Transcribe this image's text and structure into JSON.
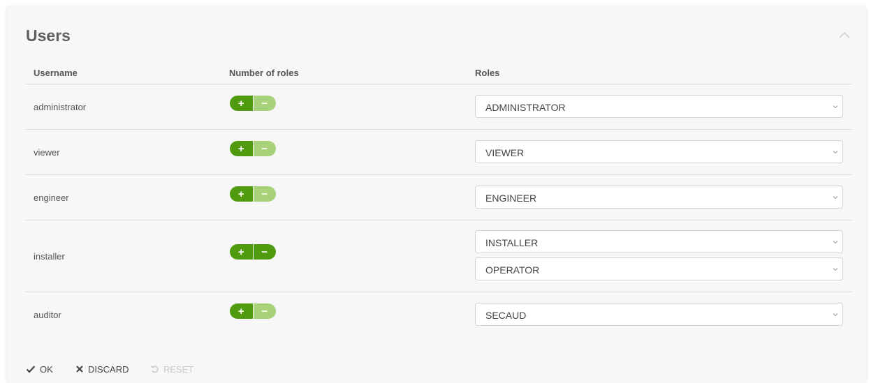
{
  "panel": {
    "title": "Users"
  },
  "table": {
    "headers": {
      "username": "Username",
      "num_roles": "Number of roles",
      "roles": "Roles"
    },
    "rows": [
      {
        "username": "administrator",
        "roles": [
          "ADMINISTRATOR"
        ],
        "minus_enabled": false
      },
      {
        "username": "viewer",
        "roles": [
          "VIEWER"
        ],
        "minus_enabled": false
      },
      {
        "username": "engineer",
        "roles": [
          "ENGINEER"
        ],
        "minus_enabled": false
      },
      {
        "username": "installer",
        "roles": [
          "INSTALLER",
          "OPERATOR"
        ],
        "minus_enabled": true
      },
      {
        "username": "auditor",
        "roles": [
          "SECAUD"
        ],
        "minus_enabled": false
      }
    ],
    "stepper": {
      "plus": "+",
      "minus": "−"
    }
  },
  "footer": {
    "ok_label": "OK",
    "discard_label": "DISCARD",
    "reset_label": "RESET"
  },
  "colors": {
    "accent": "#4f9a0f",
    "accent_disabled": "#a8d279"
  },
  "icons": {
    "collapse": "chevron-up-icon",
    "select": "chevron-down-icon",
    "ok": "check-icon",
    "discard": "x-icon",
    "reset": "undo-icon"
  }
}
